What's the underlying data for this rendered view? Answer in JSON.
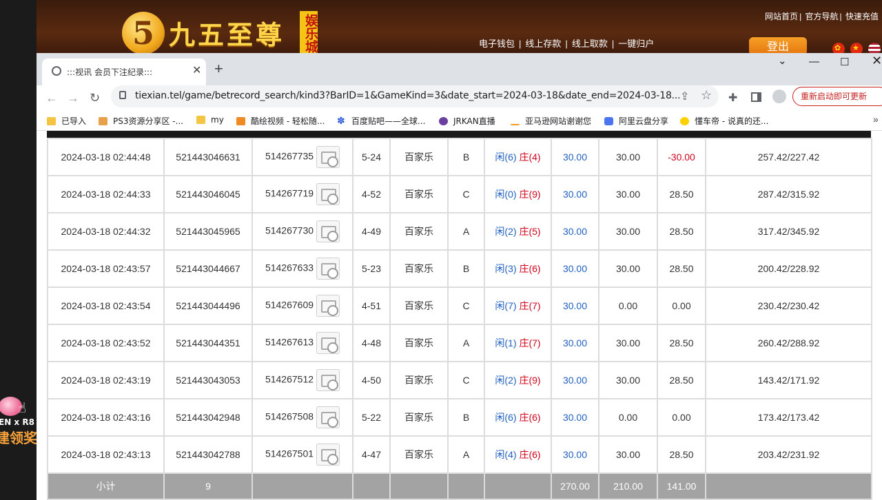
{
  "site": {
    "logo_glyph": "5",
    "logo_text": "九五至尊",
    "logo_tag": "娱乐城",
    "top_links": [
      "网站首页",
      "官方导航",
      "快速充值"
    ],
    "nav_links": [
      "电子钱包",
      "线上存款",
      "线上取款",
      "一键归户"
    ],
    "logout_label": "登出"
  },
  "promo": {
    "line1": "EN x R8",
    "line2": "建领奖"
  },
  "browser": {
    "tab_title": ":::视讯 会员下注纪录:::",
    "url": "tiexian.tel/game/betrecord_search/kind3?BarID=1&GameKind=3&date_start=2024-03-18&date_end=2024-03-18...",
    "update_label": "重新启动即可更新",
    "bookmarks": [
      {
        "label": "已导入",
        "icon": "folder-icon"
      },
      {
        "label": "PS3资源分享区 -...",
        "icon": "site-icon"
      },
      {
        "label": "my",
        "icon": "folder-icon"
      },
      {
        "label": "酷绘视频 - 轻松随...",
        "icon": "site-icon"
      },
      {
        "label": "百度贴吧——全球...",
        "icon": "paw-icon"
      },
      {
        "label": "JRKAN直播",
        "icon": "site-icon"
      },
      {
        "label": "亚马逊网站谢谢您",
        "icon": "amazon-icon"
      },
      {
        "label": "阿里云盘分享",
        "icon": "site-icon"
      },
      {
        "label": "懂车帝 - 说真的还...",
        "icon": "site-icon"
      }
    ]
  },
  "bets": [
    {
      "time": "2024-03-18 02:44:48",
      "order": "521443046631",
      "round": "514267735",
      "shoe": "5-24",
      "game": "百家乐",
      "table": "B",
      "p": "6",
      "b": "4",
      "bet": "30.00",
      "valid": "30.00",
      "win": "-30.00",
      "win_neg": true,
      "balance": "257.42/227.42"
    },
    {
      "time": "2024-03-18 02:44:33",
      "order": "521443046045",
      "round": "514267719",
      "shoe": "4-52",
      "game": "百家乐",
      "table": "C",
      "p": "0",
      "b": "9",
      "bet": "30.00",
      "valid": "30.00",
      "win": "28.50",
      "win_neg": false,
      "balance": "287.42/315.92"
    },
    {
      "time": "2024-03-18 02:44:32",
      "order": "521443045965",
      "round": "514267730",
      "shoe": "4-49",
      "game": "百家乐",
      "table": "A",
      "p": "2",
      "b": "5",
      "bet": "30.00",
      "valid": "30.00",
      "win": "28.50",
      "win_neg": false,
      "balance": "317.42/345.92"
    },
    {
      "time": "2024-03-18 02:43:57",
      "order": "521443044667",
      "round": "514267633",
      "shoe": "5-23",
      "game": "百家乐",
      "table": "B",
      "p": "3",
      "b": "6",
      "bet": "30.00",
      "valid": "30.00",
      "win": "28.50",
      "win_neg": false,
      "balance": "200.42/228.92"
    },
    {
      "time": "2024-03-18 02:43:54",
      "order": "521443044496",
      "round": "514267609",
      "shoe": "4-51",
      "game": "百家乐",
      "table": "C",
      "p": "7",
      "b": "7",
      "bet": "30.00",
      "valid": "0.00",
      "win": "0.00",
      "win_neg": false,
      "balance": "230.42/230.42"
    },
    {
      "time": "2024-03-18 02:43:52",
      "order": "521443044351",
      "round": "514267613",
      "shoe": "4-48",
      "game": "百家乐",
      "table": "A",
      "p": "1",
      "b": "7",
      "bet": "30.00",
      "valid": "30.00",
      "win": "28.50",
      "win_neg": false,
      "balance": "260.42/288.92"
    },
    {
      "time": "2024-03-18 02:43:19",
      "order": "521443043053",
      "round": "514267512",
      "shoe": "4-50",
      "game": "百家乐",
      "table": "C",
      "p": "2",
      "b": "9",
      "bet": "30.00",
      "valid": "30.00",
      "win": "28.50",
      "win_neg": false,
      "balance": "143.42/171.92"
    },
    {
      "time": "2024-03-18 02:43:16",
      "order": "521443042948",
      "round": "514267508",
      "shoe": "5-22",
      "game": "百家乐",
      "table": "B",
      "p": "6",
      "b": "6",
      "bet": "30.00",
      "valid": "0.00",
      "win": "0.00",
      "win_neg": false,
      "balance": "173.42/173.42"
    },
    {
      "time": "2024-03-18 02:43:13",
      "order": "521443042788",
      "round": "514267501",
      "shoe": "4-47",
      "game": "百家乐",
      "table": "A",
      "p": "4",
      "b": "6",
      "bet": "30.00",
      "valid": "30.00",
      "win": "28.50",
      "win_neg": false,
      "balance": "203.42/231.92"
    }
  ],
  "labels": {
    "player": "闲",
    "banker": "庄"
  },
  "subtotal": {
    "label": "小计",
    "count": "9",
    "bet": "270.00",
    "valid": "210.00",
    "win": "141.00"
  },
  "colors": {
    "player": "#1f5fbf",
    "banker": "#d0021b",
    "subtotal_bg": "#a3a3a3",
    "header_bg": "#5a2a10"
  }
}
